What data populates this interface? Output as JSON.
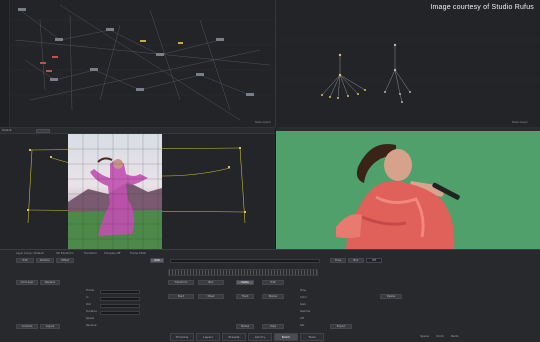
{
  "credit": "Image courtesy of Studio Rufus",
  "graph": {
    "label_left": "Node Graph",
    "label_right": "Node Graph"
  },
  "viewer": {
    "left_label": "Default",
    "right_label": "Default"
  },
  "panel": {
    "row0": [
      "Layer Comp / Default",
      "3D Transform",
      "Transform",
      "Compare Off",
      "Frame 1060"
    ],
    "row1": [
      "Edit",
      "Position",
      "Offset",
      "RGB",
      "Time",
      "Blur",
      "Off"
    ],
    "row2": [
      "Add Layer",
      "Replace",
      "Transform",
      "Blur",
      "Matte",
      "Edit"
    ],
    "row3": [
      "Paint",
      "Mask",
      "Track",
      "Stereo",
      "Delete"
    ],
    "row4": [
      "Controls",
      "Layers",
      "Nodes",
      "Clips",
      "Export"
    ],
    "labels_mid": [
      "Frame",
      "In",
      "Out",
      "Duration",
      "Speed",
      "Reverse"
    ],
    "labels_right": [
      "Tone",
      "Color",
      "Gain",
      "Gamma",
      "Lift",
      "Sat"
    ],
    "timeline_label": "Timeline"
  },
  "bottom_tabs": [
    "Timeline",
    "Layers",
    "Presets",
    "Library",
    "Batch",
    "Tools"
  ],
  "status": {
    "left": "Space",
    "mid": "Undo",
    "right": "Redo"
  },
  "colors": {
    "accent": "#5d6068",
    "green_screen": "#4fa06a",
    "node_yellow": "#d8c35a"
  }
}
